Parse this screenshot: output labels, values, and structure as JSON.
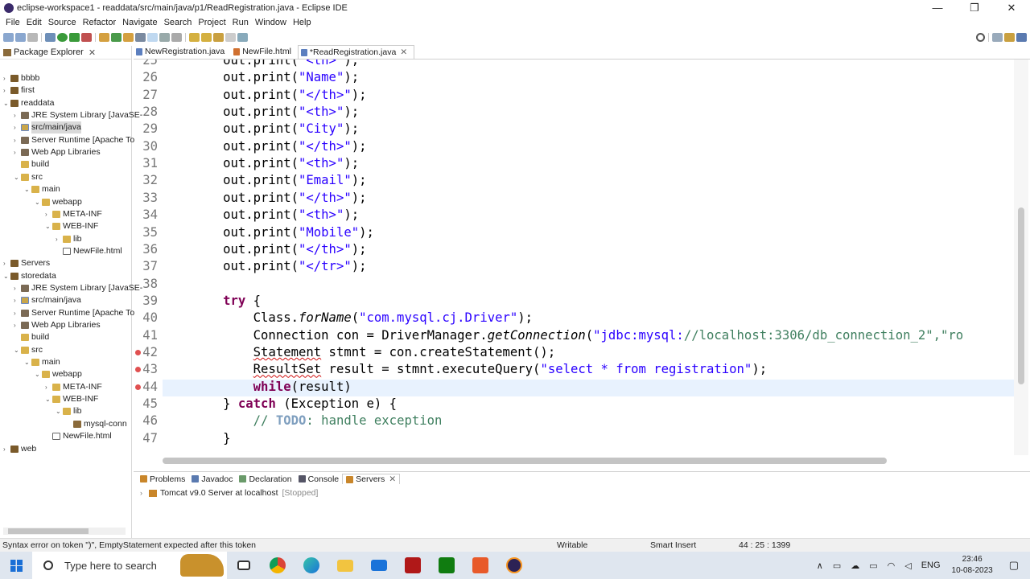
{
  "window": {
    "title": "eclipse-workspace1 - readdata/src/main/java/p1/ReadRegistration.java - Eclipse IDE",
    "minimize": "—",
    "maximize": "❐",
    "close": "✕"
  },
  "menu": [
    "File",
    "Edit",
    "Source",
    "Refactor",
    "Navigate",
    "Search",
    "Project",
    "Run",
    "Window",
    "Help"
  ],
  "package_explorer": {
    "title": "Package Explorer",
    "items": [
      {
        "label": "bbbb",
        "depth": 0,
        "arrow": "›",
        "icon": "proj"
      },
      {
        "label": "first",
        "depth": 0,
        "arrow": "›",
        "icon": "proj"
      },
      {
        "label": "readdata",
        "depth": 0,
        "arrow": "⌄",
        "icon": "proj"
      },
      {
        "label": "JRE System Library [JavaSE-",
        "depth": 1,
        "arrow": "›",
        "icon": "lib"
      },
      {
        "label": "src/main/java",
        "depth": 1,
        "arrow": "›",
        "icon": "src",
        "selected": true
      },
      {
        "label": "Server Runtime [Apache To",
        "depth": 1,
        "arrow": "›",
        "icon": "lib"
      },
      {
        "label": "Web App Libraries",
        "depth": 1,
        "arrow": "›",
        "icon": "lib"
      },
      {
        "label": "build",
        "depth": 1,
        "arrow": "",
        "icon": "folder"
      },
      {
        "label": "src",
        "depth": 1,
        "arrow": "⌄",
        "icon": "folder"
      },
      {
        "label": "main",
        "depth": 2,
        "arrow": "⌄",
        "icon": "folder"
      },
      {
        "label": "webapp",
        "depth": 3,
        "arrow": "⌄",
        "icon": "folder"
      },
      {
        "label": "META-INF",
        "depth": 4,
        "arrow": "›",
        "icon": "folder"
      },
      {
        "label": "WEB-INF",
        "depth": 4,
        "arrow": "⌄",
        "icon": "folder"
      },
      {
        "label": "lib",
        "depth": 5,
        "arrow": "›",
        "icon": "folder"
      },
      {
        "label": "NewFile.html",
        "depth": 5,
        "arrow": "",
        "icon": "file"
      },
      {
        "label": "Servers",
        "depth": 0,
        "arrow": "›",
        "icon": "proj"
      },
      {
        "label": "storedata",
        "depth": 0,
        "arrow": "⌄",
        "icon": "proj"
      },
      {
        "label": "JRE System Library [JavaSE-",
        "depth": 1,
        "arrow": "›",
        "icon": "lib"
      },
      {
        "label": "src/main/java",
        "depth": 1,
        "arrow": "›",
        "icon": "src"
      },
      {
        "label": "Server Runtime [Apache To",
        "depth": 1,
        "arrow": "›",
        "icon": "lib"
      },
      {
        "label": "Web App Libraries",
        "depth": 1,
        "arrow": "›",
        "icon": "lib"
      },
      {
        "label": "build",
        "depth": 1,
        "arrow": "",
        "icon": "folder"
      },
      {
        "label": "src",
        "depth": 1,
        "arrow": "⌄",
        "icon": "folder"
      },
      {
        "label": "main",
        "depth": 2,
        "arrow": "⌄",
        "icon": "folder"
      },
      {
        "label": "webapp",
        "depth": 3,
        "arrow": "⌄",
        "icon": "folder"
      },
      {
        "label": "META-INF",
        "depth": 4,
        "arrow": "›",
        "icon": "folder"
      },
      {
        "label": "WEB-INF",
        "depth": 4,
        "arrow": "⌄",
        "icon": "folder"
      },
      {
        "label": "lib",
        "depth": 5,
        "arrow": "⌄",
        "icon": "folder"
      },
      {
        "label": "mysql-conn",
        "depth": 6,
        "arrow": "",
        "icon": "jar"
      },
      {
        "label": "NewFile.html",
        "depth": 4,
        "arrow": "",
        "icon": "file"
      },
      {
        "label": "web",
        "depth": 0,
        "arrow": "›",
        "icon": "proj"
      }
    ]
  },
  "editor": {
    "tabs": [
      {
        "label": "NewRegistration.java",
        "active": false
      },
      {
        "label": "NewFile.html",
        "active": false
      },
      {
        "label": "*ReadRegistration.java",
        "active": true,
        "close": "✕"
      }
    ],
    "lines": [
      {
        "n": "25",
        "t": "        out.print(\"<th>\");"
      },
      {
        "n": "26",
        "t": "        out.print(\"Name\");"
      },
      {
        "n": "27",
        "t": "        out.print(\"</th>\");"
      },
      {
        "n": "28",
        "t": "        out.print(\"<th>\");"
      },
      {
        "n": "29",
        "t": "        out.print(\"City\");"
      },
      {
        "n": "30",
        "t": "        out.print(\"</th>\");"
      },
      {
        "n": "31",
        "t": "        out.print(\"<th>\");"
      },
      {
        "n": "32",
        "t": "        out.print(\"Email\");"
      },
      {
        "n": "33",
        "t": "        out.print(\"</th>\");"
      },
      {
        "n": "34",
        "t": "        out.print(\"<th>\");"
      },
      {
        "n": "35",
        "t": "        out.print(\"Mobile\");"
      },
      {
        "n": "36",
        "t": "        out.print(\"</th>\");"
      },
      {
        "n": "37",
        "t": "        out.print(\"</tr>\");"
      },
      {
        "n": "38",
        "t": ""
      },
      {
        "n": "39",
        "t": "        try {"
      },
      {
        "n": "40",
        "t": "            Class.forName(\"com.mysql.cj.Driver\");"
      },
      {
        "n": "41",
        "t": "            Connection con = DriverManager.getConnection(\"jdbc:mysql://localhost:3306/db_connection_2\",\"ro"
      },
      {
        "n": "42",
        "t": "            Statement stmnt = con.createStatement();",
        "error": true
      },
      {
        "n": "43",
        "t": "            ResultSet result = stmnt.executeQuery(\"select * from registration\");",
        "error": true
      },
      {
        "n": "44",
        "t": "            while(result)",
        "error": true,
        "current": true
      },
      {
        "n": "45",
        "t": "        } catch (Exception e) {"
      },
      {
        "n": "46",
        "t": "            // TODO: handle exception"
      },
      {
        "n": "47",
        "t": "        }"
      }
    ]
  },
  "bottom_panel": {
    "tabs": [
      "Problems",
      "Javadoc",
      "Declaration",
      "Console",
      "Servers"
    ],
    "active_tab": "Servers",
    "servers": [
      {
        "name": "Tomcat v9.0 Server at localhost",
        "state": "[Stopped]"
      }
    ]
  },
  "status": {
    "message": "Syntax error on token \")\", EmptyStatement expected after this token",
    "mode": "Writable",
    "insert": "Smart Insert",
    "position": "44 : 25 : 1399"
  },
  "taskbar": {
    "search_placeholder": "Type here to search",
    "lang": "ENG",
    "time": "23:46",
    "date": "10-08-2023"
  },
  "colors": {
    "keyword": "#7f0055",
    "string": "#2a00ff",
    "comment": "#3f7f5f",
    "error": "#d01010",
    "current_line": "#e8f2fe"
  }
}
